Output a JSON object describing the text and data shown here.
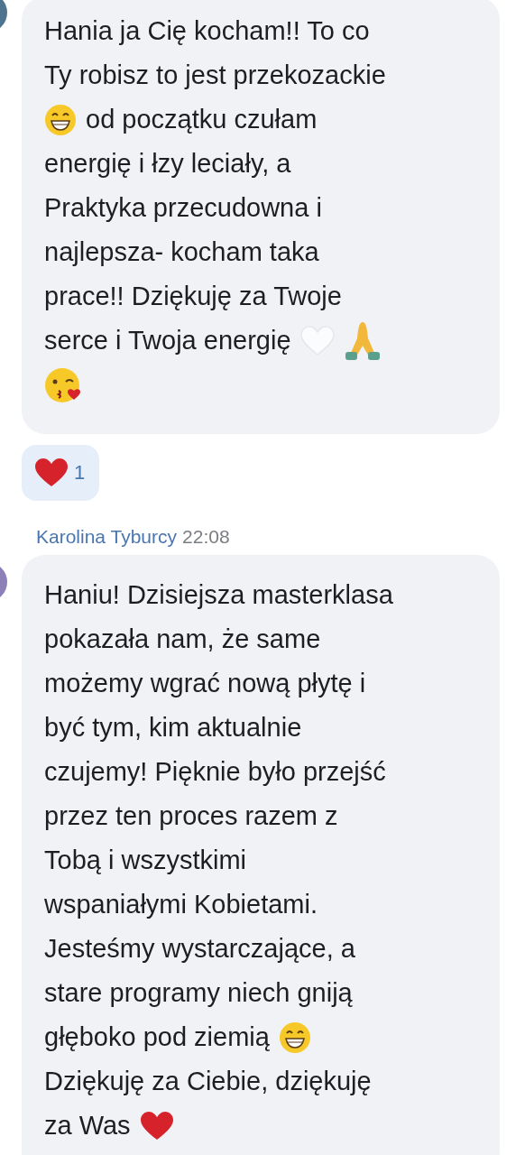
{
  "messages": [
    {
      "lines": [
        [
          {
            "kind": "text",
            "text": "Hania ja Cię kocham!! To co"
          }
        ],
        [
          {
            "kind": "text",
            "text": "Ty robisz to jest przekozackie"
          }
        ],
        [
          {
            "kind": "grin"
          },
          {
            "kind": "text",
            "text": "od początku czułam"
          }
        ],
        [
          {
            "kind": "text",
            "text": "energię i łzy leciały, a"
          }
        ],
        [
          {
            "kind": "text",
            "text": "Praktyka przecudowna i"
          }
        ],
        [
          {
            "kind": "text",
            "text": "najlepsza- kocham taka"
          }
        ],
        [
          {
            "kind": "text",
            "text": "prace!! Dziękuję za Twoje"
          }
        ],
        [
          {
            "kind": "text",
            "text": "serce i Twoja energię"
          },
          {
            "kind": "whiteheart"
          },
          {
            "kind": "pray"
          }
        ],
        [
          {
            "kind": "kiss"
          }
        ]
      ],
      "reaction": {
        "kind": "heart",
        "count": "1"
      }
    },
    {
      "author": "Karolina Tyburcy",
      "time": "22:08",
      "lines": [
        [
          {
            "kind": "text",
            "text": "Haniu! Dzisiejsza masterklasa"
          }
        ],
        [
          {
            "kind": "text",
            "text": "pokazała nam, że same"
          }
        ],
        [
          {
            "kind": "text",
            "text": "możemy wgrać nową płytę i"
          }
        ],
        [
          {
            "kind": "text",
            "text": "być tym, kim aktualnie"
          }
        ],
        [
          {
            "kind": "text",
            "text": "czujemy! Pięknie było przejść"
          }
        ],
        [
          {
            "kind": "text",
            "text": "przez ten proces razem z"
          }
        ],
        [
          {
            "kind": "text",
            "text": "Tobą i wszystkimi"
          }
        ],
        [
          {
            "kind": "text",
            "text": "wspaniałymi Kobietami."
          }
        ],
        [
          {
            "kind": "text",
            "text": "Jesteśmy wystarczające, a"
          }
        ],
        [
          {
            "kind": "text",
            "text": "stare programy niech gniją"
          }
        ],
        [
          {
            "kind": "text",
            "text": "głęboko pod ziemią"
          },
          {
            "kind": "grin"
          }
        ],
        [
          {
            "kind": "text",
            "text": "Dziękuję za Ciebie, dziękuję"
          }
        ],
        [
          {
            "kind": "text",
            "text": "za Was"
          },
          {
            "kind": "heart"
          }
        ]
      ]
    }
  ]
}
